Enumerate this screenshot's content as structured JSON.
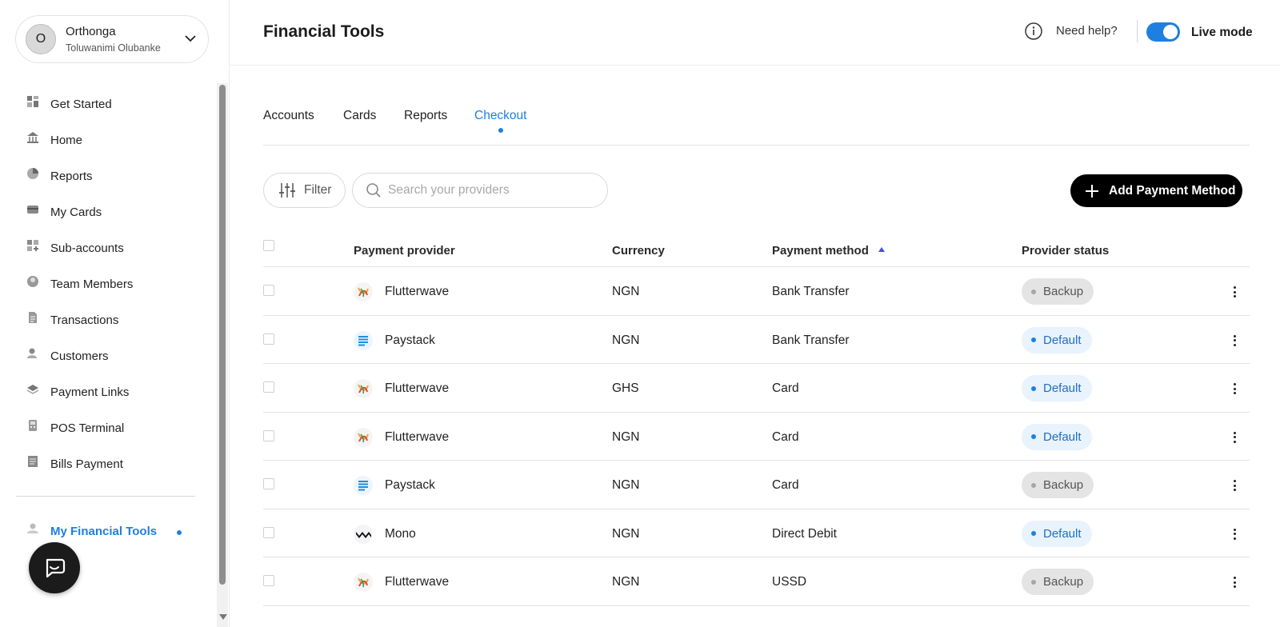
{
  "account": {
    "initial": "O",
    "name": "Orthonga",
    "subtitle": "Toluwanimi Olubanke"
  },
  "sidebar": {
    "items": [
      {
        "label": "Get Started",
        "icon": "grid-icon"
      },
      {
        "label": "Home",
        "icon": "bank-icon"
      },
      {
        "label": "Reports",
        "icon": "pie-chart-icon"
      },
      {
        "label": "My Cards",
        "icon": "card-icon"
      },
      {
        "label": "Sub-accounts",
        "icon": "add-grid-icon"
      },
      {
        "label": "Team Members",
        "icon": "team-icon"
      },
      {
        "label": "Transactions",
        "icon": "document-icon"
      },
      {
        "label": "Customers",
        "icon": "customers-icon"
      },
      {
        "label": "Payment Links",
        "icon": "layers-icon"
      },
      {
        "label": "POS Terminal",
        "icon": "pos-icon"
      },
      {
        "label": "Bills Payment",
        "icon": "receipt-icon"
      }
    ],
    "active": {
      "label": "My Financial Tools",
      "icon": "tools-icon"
    }
  },
  "header": {
    "title": "Financial Tools",
    "help": "Need help?",
    "mode": "Live mode"
  },
  "tabs": [
    {
      "label": "Accounts",
      "active": false
    },
    {
      "label": "Cards",
      "active": false
    },
    {
      "label": "Reports",
      "active": false
    },
    {
      "label": "Checkout",
      "active": true
    }
  ],
  "toolbar": {
    "filter_label": "Filter",
    "search_placeholder": "Search your providers",
    "add_label": "Add Payment Method"
  },
  "table": {
    "columns": [
      "Payment provider",
      "Currency",
      "Payment method",
      "Provider status"
    ],
    "rows": [
      {
        "provider": "Flutterwave",
        "currency": "NGN",
        "method": "Bank Transfer",
        "status": "Backup"
      },
      {
        "provider": "Paystack",
        "currency": "NGN",
        "method": "Bank Transfer",
        "status": "Default"
      },
      {
        "provider": "Flutterwave",
        "currency": "GHS",
        "method": "Card",
        "status": "Default"
      },
      {
        "provider": "Flutterwave",
        "currency": "NGN",
        "method": "Card",
        "status": "Default"
      },
      {
        "provider": "Paystack",
        "currency": "NGN",
        "method": "Card",
        "status": "Backup"
      },
      {
        "provider": "Mono",
        "currency": "NGN",
        "method": "Direct Debit",
        "status": "Default"
      },
      {
        "provider": "Flutterwave",
        "currency": "NGN",
        "method": "USSD",
        "status": "Backup"
      }
    ]
  },
  "colors": {
    "accent": "#1e7fe0",
    "primary_button": "#000000",
    "backup_badge": "#e4e4e4",
    "default_badge": "#e9f3fd"
  }
}
